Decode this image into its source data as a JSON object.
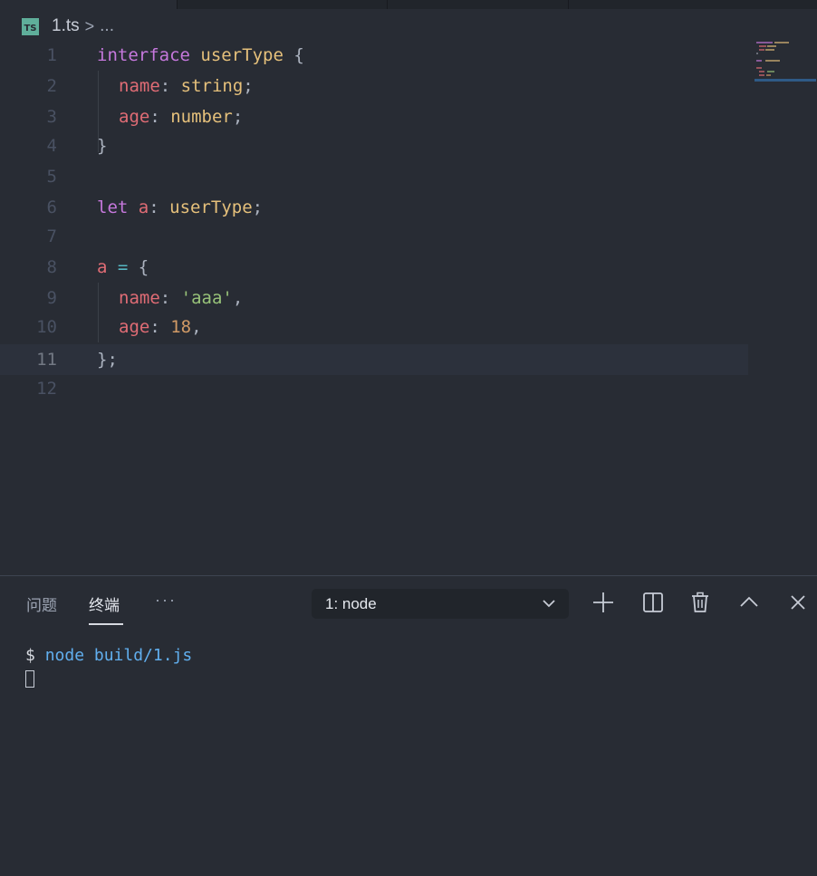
{
  "breadcrumb": {
    "icon_label": "TS",
    "file": "1.ts",
    "separator": ">",
    "more": "..."
  },
  "editor": {
    "lines": [
      {
        "n": "1"
      },
      {
        "n": "2"
      },
      {
        "n": "3"
      },
      {
        "n": "4"
      },
      {
        "n": "5"
      },
      {
        "n": "6"
      },
      {
        "n": "7"
      },
      {
        "n": "8"
      },
      {
        "n": "9"
      },
      {
        "n": "10"
      },
      {
        "n": "11"
      },
      {
        "n": "12"
      }
    ],
    "tokens": {
      "l1": [
        "interface",
        " ",
        "userType",
        " {"
      ],
      "l2": [
        "name",
        ": ",
        "string",
        ";"
      ],
      "l3": [
        "age",
        ": ",
        "number",
        ";"
      ],
      "l4": [
        "}"
      ],
      "l6": [
        "let",
        " ",
        "a",
        ": ",
        "userType",
        ";"
      ],
      "l8": [
        "a",
        " ",
        "=",
        " {"
      ],
      "l9": [
        "name",
        ": ",
        "'aaa'",
        ","
      ],
      "l10": [
        "age",
        ": ",
        "18",
        ","
      ],
      "l11": [
        "};"
      ]
    }
  },
  "panel": {
    "tabs": [
      {
        "label": "问题"
      },
      {
        "label": "终端"
      }
    ],
    "more": "···",
    "terminal_select": "1: node",
    "actions": [
      "add-icon",
      "split-icon",
      "trash-icon",
      "chevron-up-icon",
      "close-icon"
    ]
  },
  "terminal": {
    "prompt": "$",
    "command": "node build/1.js"
  },
  "colors": {
    "background": "#282c34",
    "keyword": "#c678dd",
    "type": "#e5c07b",
    "property": "#e06c75",
    "string": "#98c379",
    "number": "#d19a66",
    "command": "#61afef"
  }
}
